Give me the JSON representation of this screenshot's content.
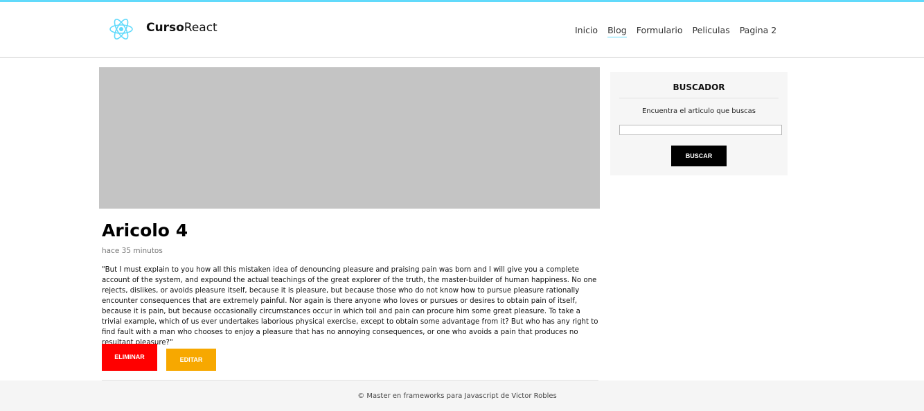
{
  "header": {
    "brand_bold": "Curso",
    "brand_light": "React",
    "logo_icon": "react-atom-icon",
    "accent_color": "#61dafb",
    "nav": [
      "Inicio",
      "Blog",
      "Formulario",
      "Peliculas",
      "Pagina 2"
    ],
    "active_nav": "Blog"
  },
  "article": {
    "title": "Aricolo 4",
    "date": "hace 35 minutos",
    "body": "\"But I must explain to you how all this mistaken idea of denouncing pleasure and praising pain was born and I will give you a complete account of the system, and expound the actual teachings of the great explorer of the truth, the master-builder of human happiness. No one rejects, dislikes, or avoids pleasure itself, because it is pleasure, but because those who do not know how to pursue pleasure rationally encounter consequences that are extremely painful. Nor again is there anyone who loves or pursues or desires to obtain pain of itself, because it is pain, but because occasionally circumstances occur in which toil and pain can procure him some great pleasure. To take a trivial example, which of us ever undertakes laborious physical exercise, except to obtain some advantage from it? But who has any right to find fault with a man who chooses to enjoy a pleasure that has no annoying consequences, or one who avoids a pain that produces no resultant pleasure?\"",
    "delete_label": "ELIMINAR",
    "edit_label": "EDITAR",
    "delete_color": "#ff0000",
    "edit_color": "#f7a800"
  },
  "sidebar": {
    "title": "BUSCADOR",
    "text": "Encuentra el articulo que buscas",
    "search_value": "",
    "button_label": "BUSCAR"
  },
  "footer": {
    "text": "© Master en frameworks para Javascript de Victor Robles"
  }
}
